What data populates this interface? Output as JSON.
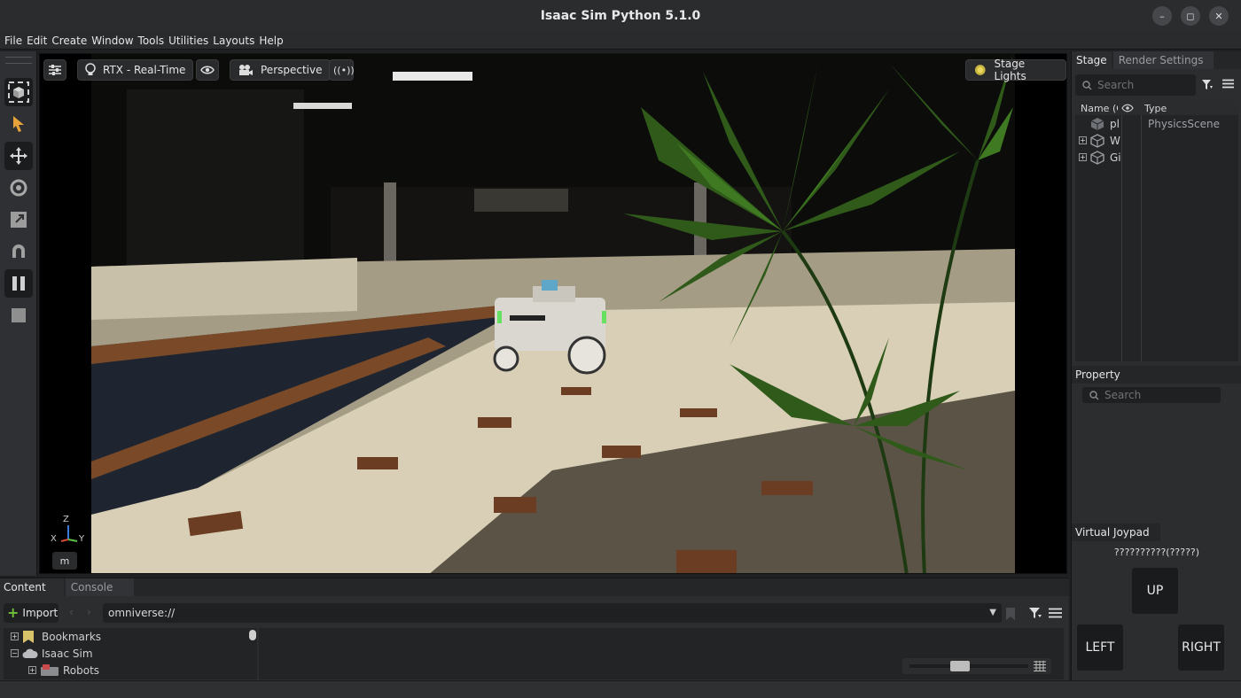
{
  "window": {
    "title": "Isaac Sim Python 5.1.0",
    "minimize": "–",
    "maximize": "◻",
    "close": "✕"
  },
  "menu": [
    "File",
    "Edit",
    "Create",
    "Window",
    "Tools",
    "Utilities",
    "Layouts",
    "Help"
  ],
  "viewport": {
    "renderer_label": "RTX - Real-Time",
    "camera_label": "Perspective",
    "lights_label": "Stage Lights",
    "axis": {
      "z": "Z",
      "x": "X",
      "y": "Y"
    },
    "units_button": "m"
  },
  "stage_panel": {
    "tabs": [
      "Stage",
      "Render Settings"
    ],
    "search_placeholder": "Search",
    "columns": {
      "name": "Name (O",
      "type": "Type"
    },
    "rows": [
      {
        "name": "pl",
        "type": "PhysicsScene",
        "expandable": false
      },
      {
        "name": "W",
        "type": "",
        "expandable": true
      },
      {
        "name": "Gi",
        "type": "",
        "expandable": true
      }
    ]
  },
  "property_panel": {
    "title": "Property",
    "search_placeholder": "Search"
  },
  "joypad": {
    "title": "Virtual Joypad",
    "subtitle": "??????????(?????)",
    "up": "UP",
    "left": "LEFT",
    "right": "RIGHT"
  },
  "content_panel": {
    "tabs": [
      "Content",
      "Console"
    ],
    "import_label": "Import",
    "path": "omniverse://",
    "tree": [
      {
        "label": "Bookmarks",
        "expander": "+"
      },
      {
        "label": "Isaac Sim",
        "expander": "−"
      },
      {
        "label": "Robots",
        "expander": "+"
      }
    ]
  },
  "colors": {
    "accent_green": "#6fbf3a",
    "panel": "#2c2d2f",
    "toolbar": "#2f3033"
  }
}
